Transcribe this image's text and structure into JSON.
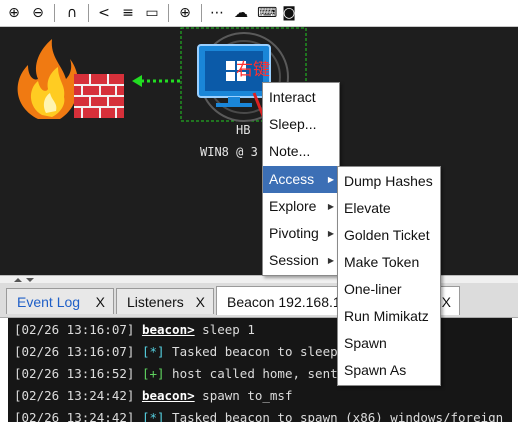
{
  "toolbar": {
    "icons": [
      "plus-circle-icon",
      "minus-circle-icon",
      "headset-icon",
      "share-icon",
      "list-icon",
      "monitor-icon",
      "globe-icon",
      "dots-icon",
      "cloud-download-icon",
      "keyboard-icon",
      "camera-icon"
    ],
    "glyphs": [
      "⊕",
      "⊖",
      "∩",
      "<",
      "≡",
      "▭",
      "⊕",
      "⋯",
      "☁",
      "⌨",
      "◙"
    ]
  },
  "graph": {
    "host_label": "HB",
    "host_sub": "WIN8 @ 3",
    "chinese_overlay": "右键",
    "colors": {
      "background": "#1e1e1e",
      "selection_box": "#22cc22",
      "arrow": "#dd2222"
    }
  },
  "context_menu": {
    "items": [
      {
        "label": "Interact"
      },
      {
        "label": "Sleep..."
      },
      {
        "label": "Note..."
      },
      {
        "label": "Access",
        "submenu": true,
        "selected": true
      },
      {
        "label": "Explore",
        "submenu": true
      },
      {
        "label": "Pivoting",
        "submenu": true
      },
      {
        "label": "Session",
        "submenu": true
      }
    ]
  },
  "access_submenu": {
    "items": [
      "Dump Hashes",
      "Elevate",
      "Golden Ticket",
      "Make Token",
      "One-liner",
      "Run Mimikatz",
      "Spawn",
      "Spawn As"
    ]
  },
  "tabs": [
    {
      "label": "Event Log",
      "close": "X"
    },
    {
      "label": "Listeners",
      "close": "X"
    },
    {
      "label": "Beacon 192.168.1",
      "close": "X",
      "active": true
    }
  ],
  "console": {
    "lines": [
      {
        "ts": "[02/26 13:16:07]",
        "prompt": "beacon>",
        "text": " sleep 1"
      },
      {
        "ts": "[02/26 13:16:07]",
        "mark": "[*]",
        "text": " Tasked beacon to sleep for 1s"
      },
      {
        "ts": "[02/26 13:16:52]",
        "mark": "[+]",
        "text": " host called home, sent: 16 bytes"
      },
      {
        "ts": "[02/26 13:24:42]",
        "prompt": "beacon>",
        "text": " spawn to_msf"
      },
      {
        "ts": "[02/26 13:24:42]",
        "mark": "[*]",
        "text": " Tasked beacon to spawn (x86) windows/foreign"
      }
    ]
  }
}
